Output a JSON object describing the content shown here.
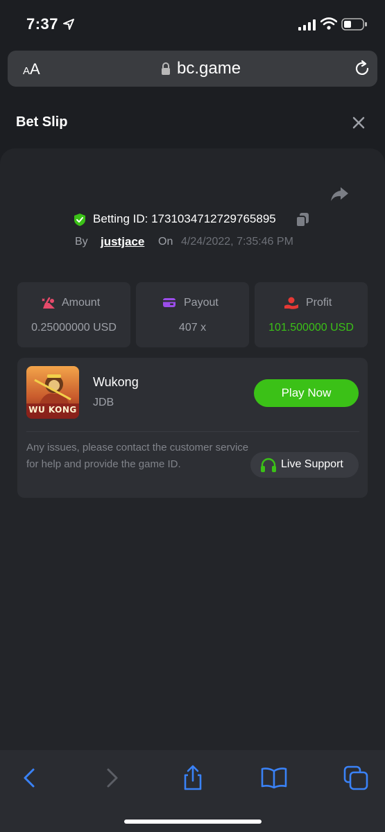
{
  "status_bar": {
    "time": "7:37"
  },
  "browser": {
    "aa_label_small": "A",
    "aa_label_big": "A",
    "url": "bc.game"
  },
  "modal": {
    "title": "Bet Slip"
  },
  "bet": {
    "betting_id_label": "Betting ID: 1731034712729765895",
    "by_label": "By",
    "username": "justjace",
    "on_label": "On",
    "date": "4/24/2022, 7:35:46 PM"
  },
  "stats": [
    {
      "label": "Amount",
      "value": "0.25000000 USD"
    },
    {
      "label": "Payout",
      "value": "407 x"
    },
    {
      "label": "Profit",
      "value": "101.500000 USD"
    }
  ],
  "game": {
    "name": "Wukong",
    "provider": "JDB",
    "thumb_text": "WU KONG",
    "play_label": "Play Now"
  },
  "support": {
    "issue_text": "Any issues, please contact the customer service for help and provide the game ID.",
    "button_label": "Live Support"
  },
  "colors": {
    "accent_green": "#3bc117",
    "background": "#1c1e22",
    "card": "#2d2f34",
    "toolbar_icon": "#3a82f7"
  }
}
